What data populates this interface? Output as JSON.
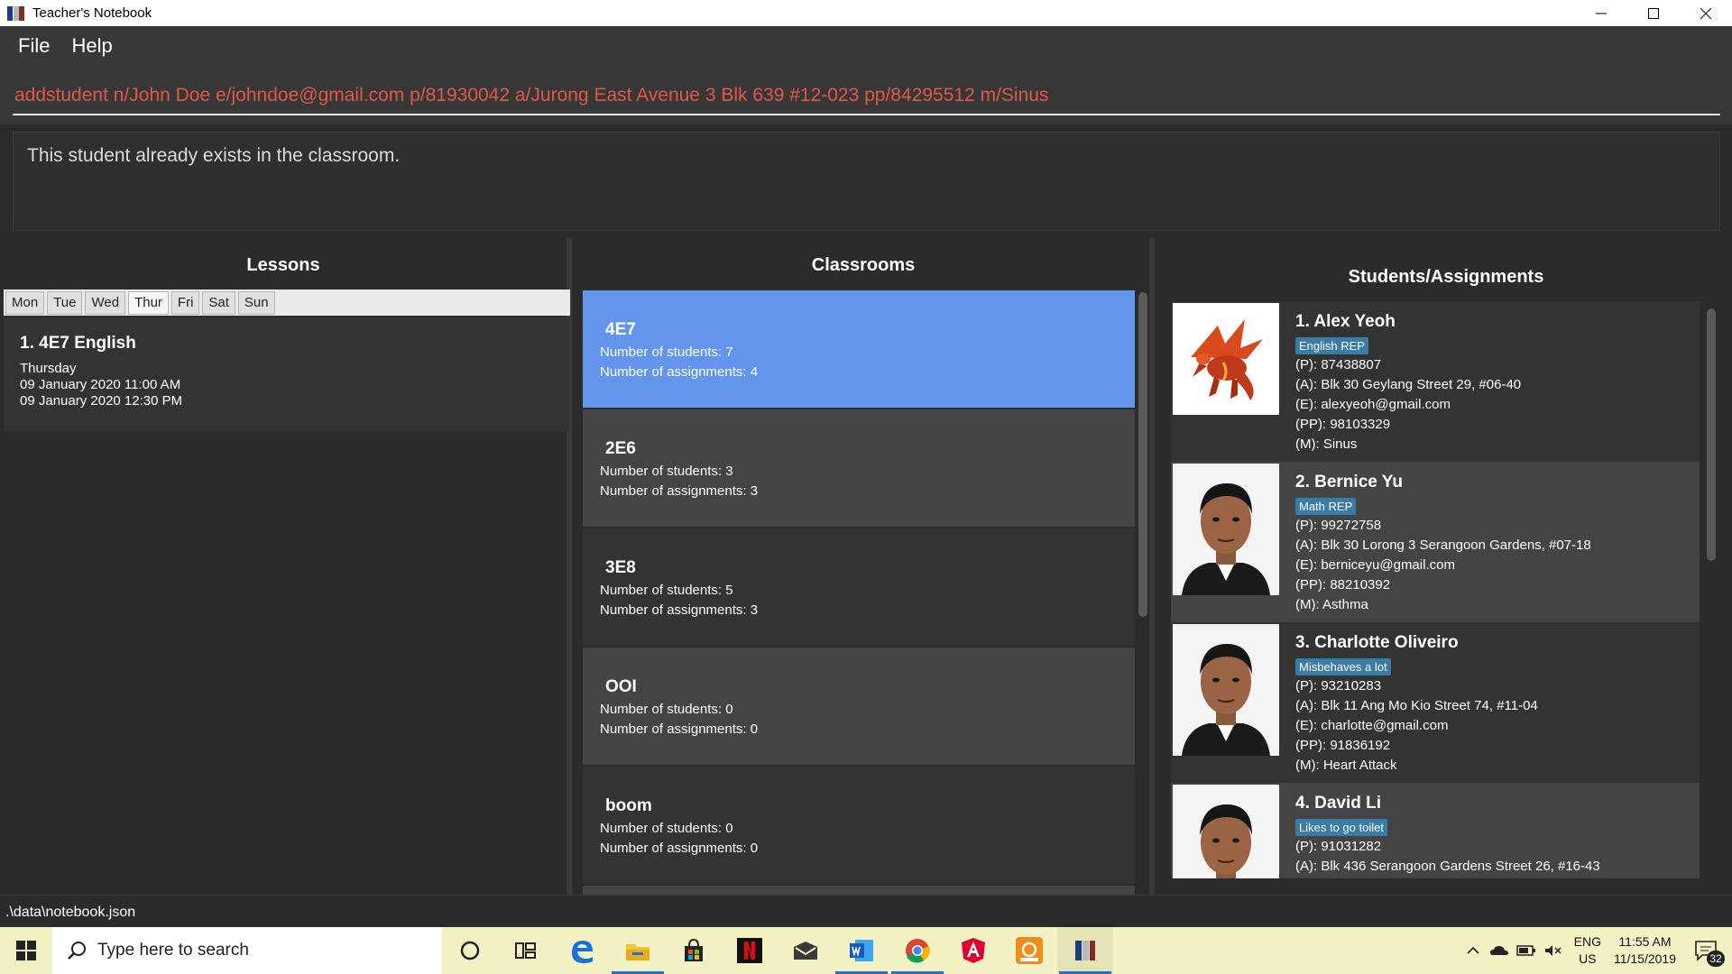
{
  "window": {
    "title": "Teacher's Notebook"
  },
  "menu": [
    "File",
    "Help"
  ],
  "command": {
    "value": "addstudent n/John Doe e/johndoe@gmail.com p/81930042 a/Jurong East Avenue 3 Blk 639 #12-023 pp/84295512 m/Sinus"
  },
  "result": {
    "text": "This student already exists in the classroom."
  },
  "lessons": {
    "title": "Lessons",
    "days": [
      "Mon",
      "Tue",
      "Wed",
      "Thur",
      "Fri",
      "Sat",
      "Sun"
    ],
    "active_day": "Thur",
    "items": [
      {
        "name": "1.  4E7 English",
        "day": "Thursday",
        "start": "09 January 2020 11:00 AM",
        "end": "09 January 2020 12:30 PM"
      }
    ]
  },
  "classrooms": {
    "title": "Classrooms",
    "items": [
      {
        "name": "4E7",
        "students": "Number of students: 7",
        "assignments": "Number of assignments: 4",
        "selected": true
      },
      {
        "name": "2E6",
        "students": "Number of students: 3",
        "assignments": "Number of assignments: 3"
      },
      {
        "name": "3E8",
        "students": "Number of students: 5",
        "assignments": "Number of assignments: 3"
      },
      {
        "name": "OOI",
        "students": "Number of students: 0",
        "assignments": "Number of assignments: 0"
      },
      {
        "name": "boom",
        "students": "Number of students: 0",
        "assignments": "Number of assignments: 0"
      }
    ]
  },
  "students": {
    "title": "Students/Assignments",
    "items": [
      {
        "name": "1.  Alex Yeoh",
        "tag": "English REP",
        "phone": "(P): 87438807",
        "address": "(A): Blk 30 Geylang Street 29, #06-40",
        "email": "(E): alexyeoh@gmail.com",
        "parent_phone": "(PP): 98103329",
        "medical": "(M): Sinus",
        "photo": "dragon-image"
      },
      {
        "name": "2.  Bernice Yu",
        "tag": "Math REP",
        "phone": "(P): 99272758",
        "address": "(A): Blk 30 Lorong 3 Serangoon Gardens, #07-18",
        "email": "(E): berniceyu@gmail.com",
        "parent_phone": "(PP): 88210392",
        "medical": "(M): Asthma",
        "photo": "portrait-image"
      },
      {
        "name": "3.  Charlotte Oliveiro",
        "tag": "Misbehaves a lot",
        "phone": "(P): 93210283",
        "address": "(A): Blk 11 Ang Mo Kio Street 74, #11-04",
        "email": "(E): charlotte@gmail.com",
        "parent_phone": "(PP): 91836192",
        "medical": "(M): Heart Attack",
        "photo": "portrait-image"
      },
      {
        "name": "4.  David Li",
        "tag": "Likes to go toilet",
        "phone": "(P): 91031282",
        "address": "(A): Blk 436 Serangoon Gardens Street 26, #16-43",
        "photo": "portrait-image"
      }
    ]
  },
  "status": {
    "path": ".\\data\\notebook.json"
  },
  "taskbar": {
    "search_placeholder": "Type here to search",
    "lang": "ENG",
    "region": "US",
    "time": "11:55 AM",
    "date": "11/15/2019",
    "notifications": "32"
  },
  "colors": {
    "accent": "#6495ed",
    "card_dark": "#333333",
    "card_light": "#444444",
    "tag": "#3a7ca5",
    "command_text": "#e0584a"
  }
}
